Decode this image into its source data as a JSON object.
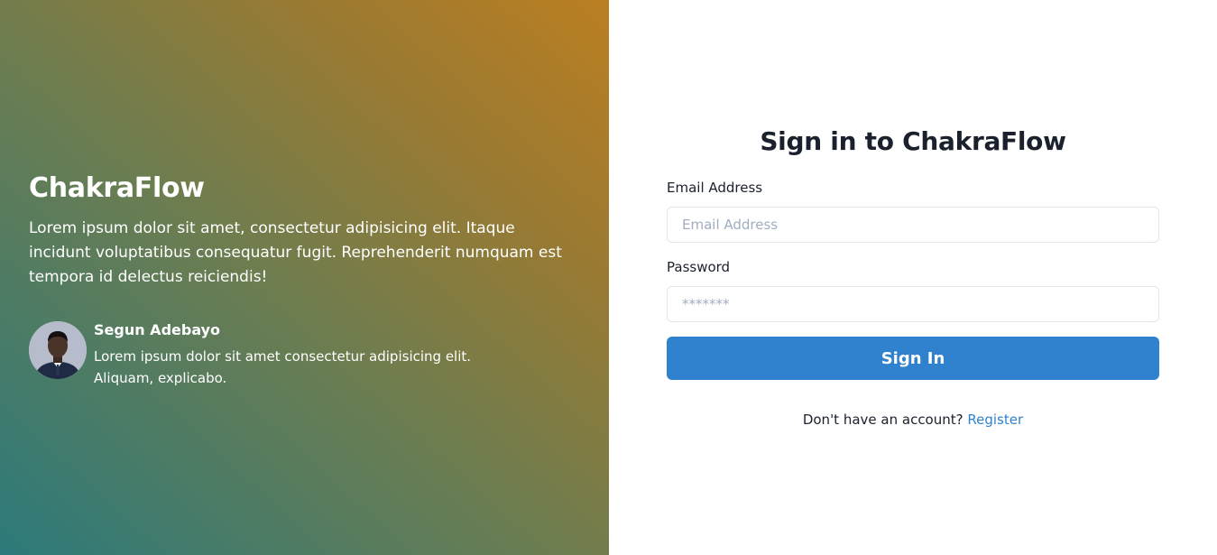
{
  "hero": {
    "brand": "ChakraFlow",
    "tagline": "Lorem ipsum dolor sit amet, consectetur adipisicing elit. Itaque incidunt voluptatibus consequatur fugit. Reprehenderit numquam est tempora id delectus reiciendis!",
    "gradient_colors": [
      "#2c7a7b",
      "#6b7d51",
      "#bb7f22"
    ],
    "testimonial": {
      "name": "Segun Adebayo",
      "quote": "Lorem ipsum dolor sit amet consectetur adipisicing elit. Aliquam, explicabo.",
      "avatar_icon": "person-avatar-icon"
    }
  },
  "form": {
    "title": "Sign in to ChakraFlow",
    "email": {
      "label": "Email Address",
      "placeholder": "Email Address",
      "value": ""
    },
    "password": {
      "label": "Password",
      "placeholder": "*******",
      "value": ""
    },
    "submit_label": "Sign In",
    "register_prompt": "Don't have an account?",
    "register_link": "Register",
    "accent_color": "#3182ce"
  }
}
